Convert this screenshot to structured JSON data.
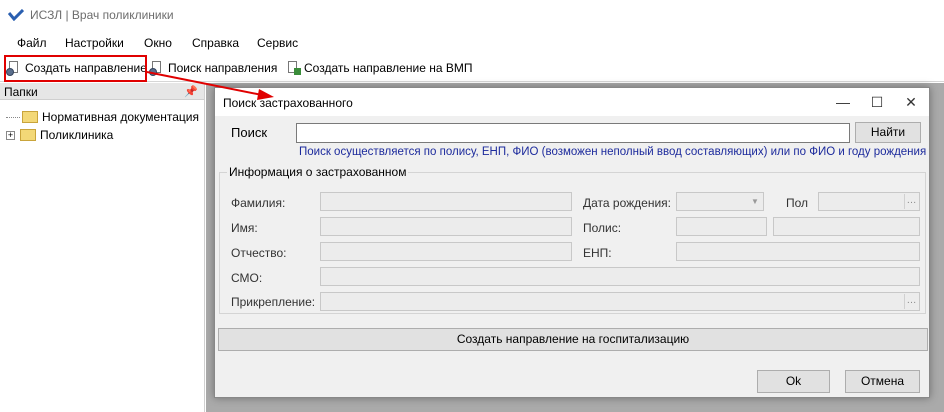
{
  "window": {
    "title": "ИСЗЛ | Врач поликлиники"
  },
  "menu": [
    "Файл",
    "Настройки",
    "Окно",
    "Справка",
    "Сервис"
  ],
  "toolbar": {
    "create_referral": "Создать направление",
    "search_referral": "Поиск направления",
    "create_referral_vmp": "Создать направление на ВМП"
  },
  "folders": {
    "title": "Папки",
    "items": [
      "Нормативная документация",
      "Поликлиника"
    ]
  },
  "dialog": {
    "title": "Поиск застрахованного",
    "search_label": "Поиск",
    "search_value": "",
    "find_button": "Найти",
    "hint": "Поиск осуществляется по полису, ЕНП, ФИО (возможен неполный ввод составляющих) или по ФИО и году рождения",
    "group_title": "Информация о застрахованном",
    "fields": {
      "surname": "Фамилия:",
      "name": "Имя:",
      "patronymic": "Отчество:",
      "smo": "СМО:",
      "attachment": "Прикрепление:",
      "birth_date": "Дата рождения:",
      "policy": "Полис:",
      "enp": "ЕНП:",
      "sex": "Пол"
    },
    "create_hosp_button": "Создать направление на госпитализацию",
    "ok_button": "Ok",
    "cancel_button": "Отмена"
  },
  "colors": {
    "annotation": "#e00000",
    "hint_text": "#1c2a9c"
  }
}
